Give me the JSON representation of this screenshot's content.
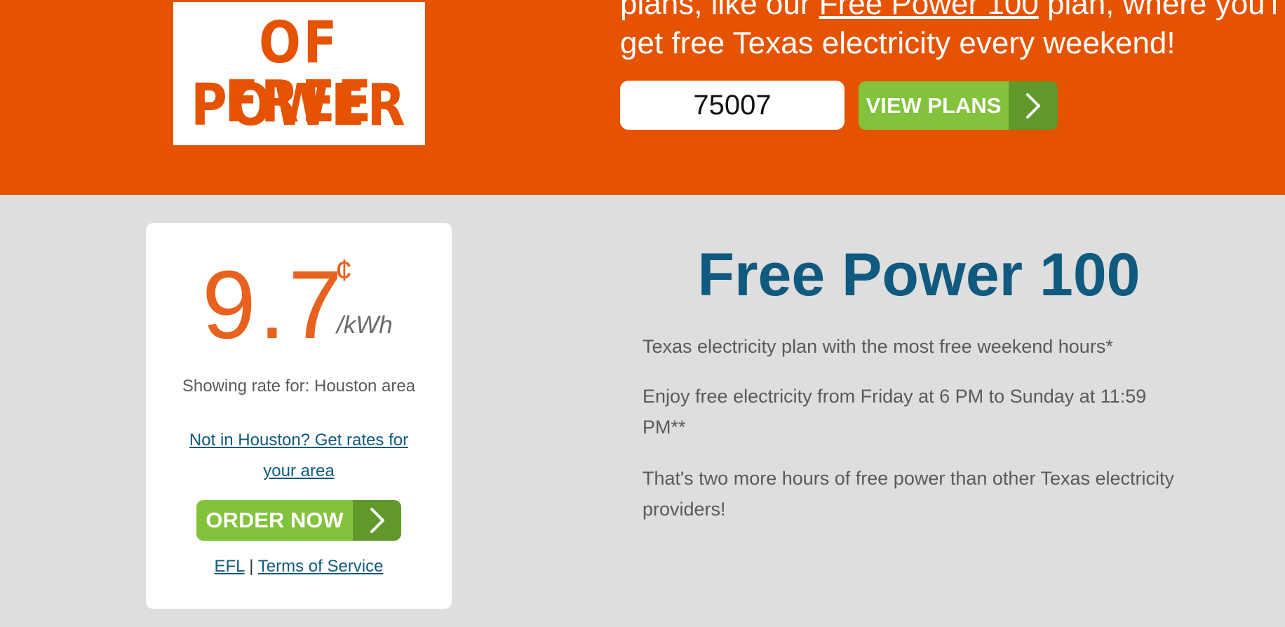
{
  "hero": {
    "logo_line1": "OF FREE",
    "logo_line2": "POWER",
    "text_before_link": "plans, like our ",
    "text_link": "Free Power 100",
    "text_after_link": " plan, where you'll",
    "text_line2": "get free Texas electricity every weekend!",
    "zip_value": "75007",
    "view_plans_label": "VIEW PLANS"
  },
  "card": {
    "rate": "9.7",
    "cent_symbol": "¢",
    "unit": "/kWh",
    "showing_rate": "Showing rate for: Houston area",
    "area_link_line1": "Not in Houston? Get rates for",
    "area_link_line2": "your area",
    "order_label": "ORDER NOW",
    "efl_label": "EFL",
    "separator": "|",
    "tos_label": "Terms of Service"
  },
  "plan": {
    "title": "Free Power 100",
    "desc1": "Texas electricity plan with the most free weekend hours*",
    "desc2_line1": "Enjoy free electricity from Friday at 6 PM to Sunday at 11:59",
    "desc2_line2": "PM**",
    "desc3_line1": "That's two more hours of free power than other Texas electricity",
    "desc3_line2": "providers!"
  },
  "colors": {
    "hero_orange": "#e55300",
    "rate_orange": "#e9611e",
    "link_blue": "#0f5a7e",
    "button_green": "#83c23b",
    "button_green_dark": "#61982a",
    "page_gray": "#dedede"
  },
  "icons": {
    "button_arrow": "chevron-right-icon"
  }
}
